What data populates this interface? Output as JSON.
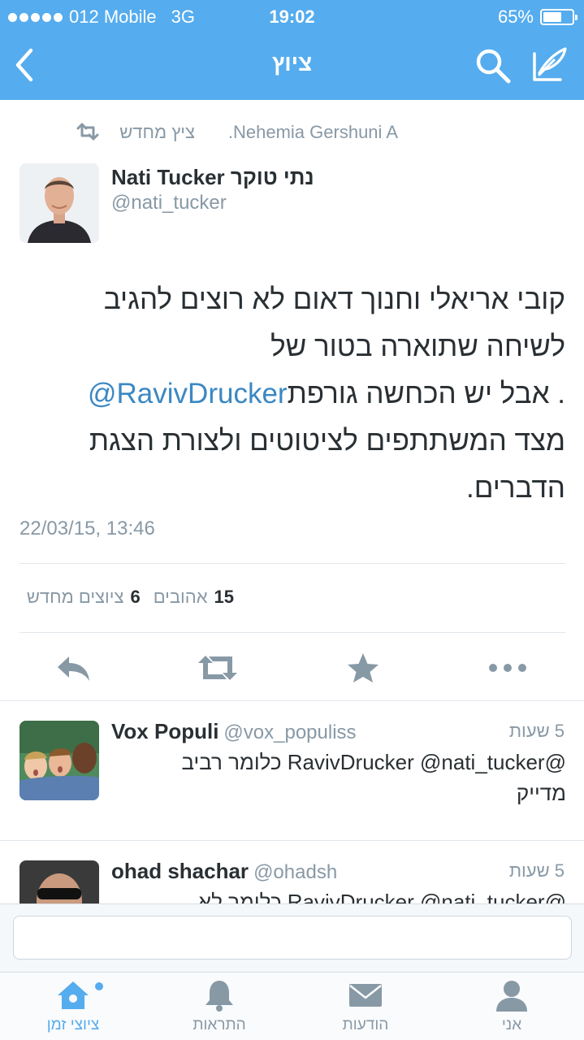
{
  "status_bar": {
    "carrier": "012 Mobile",
    "network": "3G",
    "time": "19:02",
    "battery": "65%",
    "battery_level": 0.65
  },
  "nav": {
    "title": "ציוץ",
    "back_icon": "chevron-left-icon",
    "search_icon": "search-icon",
    "compose_icon": "compose-icon"
  },
  "tweet": {
    "retweeted_by": "Nehemia Gershuni A.",
    "retweet_label": "ציץ מחדש",
    "author_name": "Nati Tucker נתי טוקר",
    "author_handle": "@nati_tucker",
    "text_line1": "קובי אריאלי וחנוך דאום לא רוצים להגיב",
    "text_line2": "לשיחה שתוארה בטור של",
    "text_mention": "@RavivDrucker",
    "text_line3_rest": " . אבל יש הכחשה גורפת",
    "text_line4": "מצד המשתתפים לציטוטים ולצורת הצגת",
    "text_line5": "הדברים.",
    "timestamp": "22/03/15, 13:46",
    "likes_count": "15",
    "likes_label": "אהובים",
    "retweets_count": "6",
    "retweets_label": "ציוצים מחדש"
  },
  "actions": [
    "reply-icon",
    "retweet-icon",
    "favorite-icon",
    "more-icon"
  ],
  "replies": [
    {
      "name": "Vox Populi",
      "handle": "@vox_populiss",
      "time": "5 שעות",
      "text_line1": "@RavivDrucker @nati_tucker כלומר רביב",
      "text_line2": "מדייק"
    },
    {
      "name": "ohad shachar",
      "handle": "@ohadsh",
      "time": "5 שעות",
      "text_line1": "@RavivDrucker @nati_tucker כלומר לא"
    }
  ],
  "composer": {
    "placeholder": ""
  },
  "tabs": [
    {
      "label": "ציוצי זמן",
      "icon": "home-icon"
    },
    {
      "label": "התראות",
      "icon": "bell-icon"
    },
    {
      "label": "הודעות",
      "icon": "envelope-icon"
    },
    {
      "label": "אני",
      "icon": "person-icon"
    }
  ],
  "colors": {
    "brand": "#55acee",
    "link": "#3b88c3",
    "muted": "#8899a6",
    "text": "#292f33"
  }
}
